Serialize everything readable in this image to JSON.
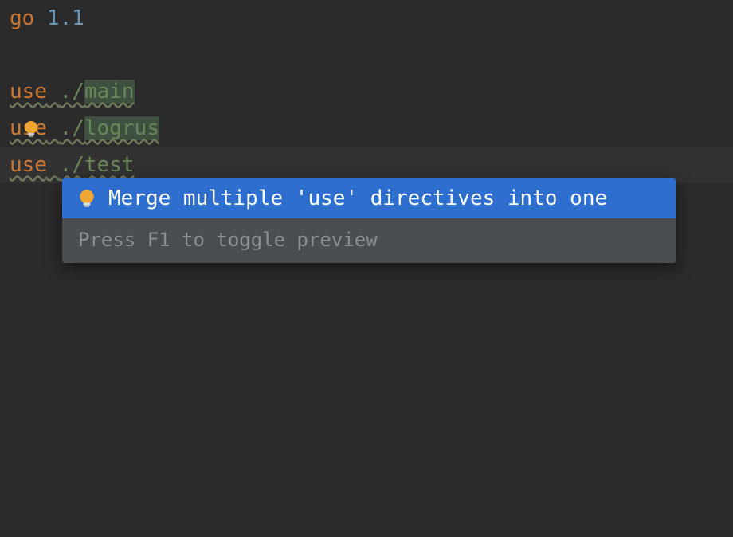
{
  "code": {
    "go_keyword": "go",
    "go_version": "1.1",
    "lines": [
      {
        "kw": "use",
        "space": " ",
        "prefix": "./",
        "name": "main"
      },
      {
        "kw": "use",
        "space": " ",
        "prefix": "./",
        "name": "logrus"
      },
      {
        "kw": "use",
        "space": " ",
        "prefix": "./",
        "name": "test"
      }
    ]
  },
  "intention_popup": {
    "action_label": "Merge multiple 'use' directives into one",
    "hint": "Press F1 to toggle preview"
  },
  "icons": {
    "bulb": "lightbulb-icon"
  },
  "colors": {
    "selection_blue": "#2e6ecf",
    "bulb_fill": "#f0a732"
  }
}
